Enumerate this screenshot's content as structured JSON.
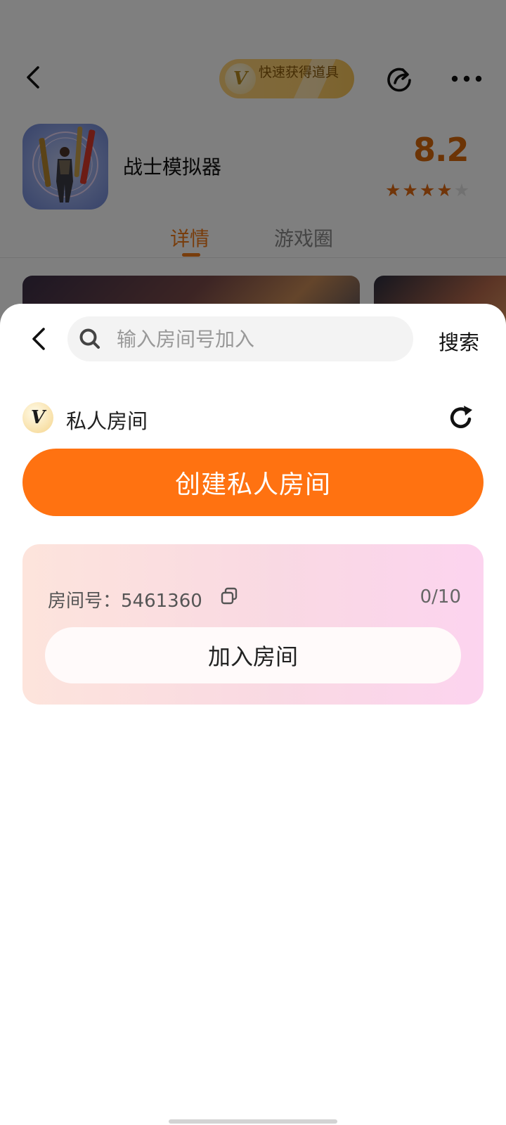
{
  "background": {
    "vip_pill_text": "快速获得道具",
    "vip_badge_letter": "V",
    "app_title": "战士模拟器",
    "score": "8.2",
    "stars": [
      "★",
      "★",
      "★",
      "★",
      "★"
    ],
    "rating_stars": 4,
    "tabs": [
      {
        "label": "详情",
        "active": true
      },
      {
        "label": "游戏圈",
        "active": false
      }
    ]
  },
  "sheet": {
    "search": {
      "placeholder": "输入房间号加入",
      "value": ""
    },
    "search_button": "搜索",
    "section": {
      "badge_letter": "V",
      "title": "私人房间"
    },
    "create_button": "创建私人房间",
    "room": {
      "label": "房间号：5461360",
      "count": "0/10",
      "join_button": "加入房间"
    }
  },
  "colors": {
    "accent": "#ff7211",
    "tab_active": "#f07a18",
    "score": "#d9680a"
  }
}
